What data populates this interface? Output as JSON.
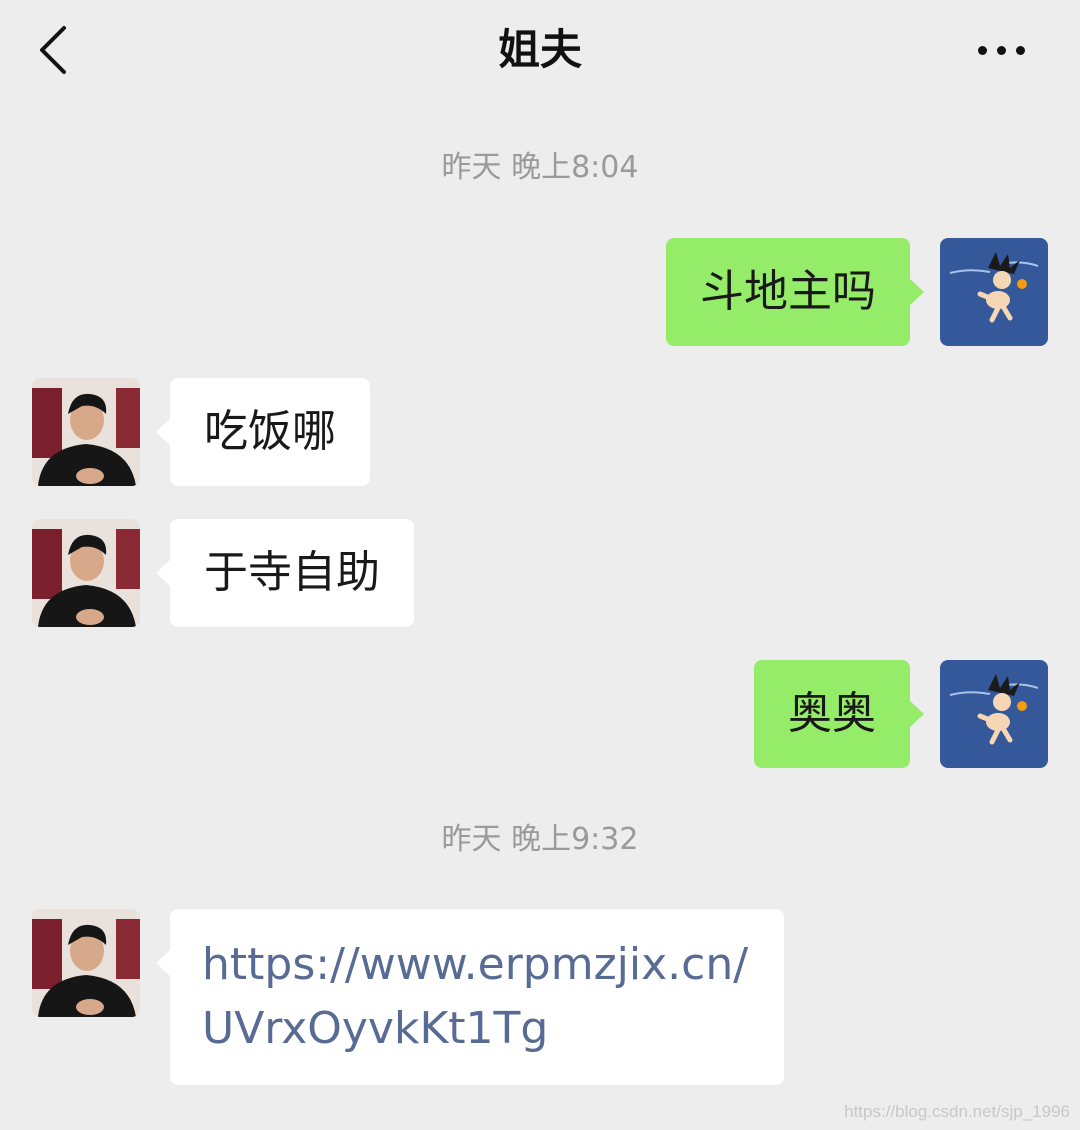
{
  "header": {
    "title": "姐夫"
  },
  "messages": {
    "timestamp_1": "昨天 晚上8:04",
    "msg_1": "斗地主吗",
    "msg_2": "吃饭哪",
    "msg_3": "于寺自助",
    "msg_4": "奥奥",
    "timestamp_2": "昨天 晚上9:32",
    "msg_5": "https://www.erpmzjix.cn/UVrxOyvkKt1Tg"
  },
  "watermark": "https://blog.csdn.net/sjp_1996",
  "colors": {
    "background": "#ededed",
    "my_bubble": "#95ec69",
    "their_bubble": "#ffffff",
    "link": "#576b95",
    "timestamp": "#9a9a9a"
  },
  "icons": {
    "back": "chevron-left-icon",
    "more": "more-dots-icon"
  }
}
